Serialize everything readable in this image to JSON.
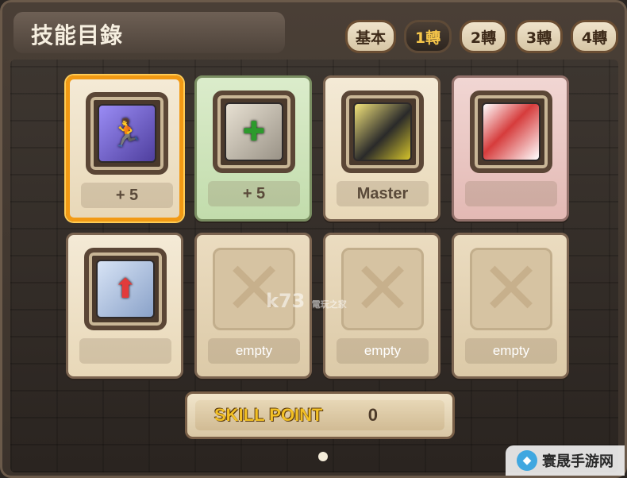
{
  "window": {
    "title": "技能目錄"
  },
  "tabs": [
    {
      "label": "基本",
      "active": false
    },
    {
      "label": "1轉",
      "active": true
    },
    {
      "label": "2轉",
      "active": false
    },
    {
      "label": "3轉",
      "active": false
    },
    {
      "label": "4轉",
      "active": false
    }
  ],
  "skills": [
    {
      "icon": "running-skill-icon",
      "label": "+ 5",
      "style": "selected"
    },
    {
      "icon": "healing-staff-icon",
      "label": "+ 5",
      "style": "green"
    },
    {
      "icon": "beast-claw-icon",
      "label": "Master",
      "style": "normal"
    },
    {
      "icon": "red-spiral-icon",
      "label": "",
      "style": "pink"
    },
    {
      "icon": "power-boost-icon",
      "label": "",
      "style": "normal"
    },
    {
      "icon": "empty-slot-icon",
      "label": "empty",
      "style": "empty"
    },
    {
      "icon": "empty-slot-icon",
      "label": "empty",
      "style": "empty"
    },
    {
      "icon": "empty-slot-icon",
      "label": "empty",
      "style": "empty"
    }
  ],
  "skill_point": {
    "label": "SKILL POINT",
    "value": "0"
  },
  "watermark": {
    "text": "k73",
    "sub": "電玩之家"
  },
  "brand": {
    "text": "寰晟手游网"
  }
}
